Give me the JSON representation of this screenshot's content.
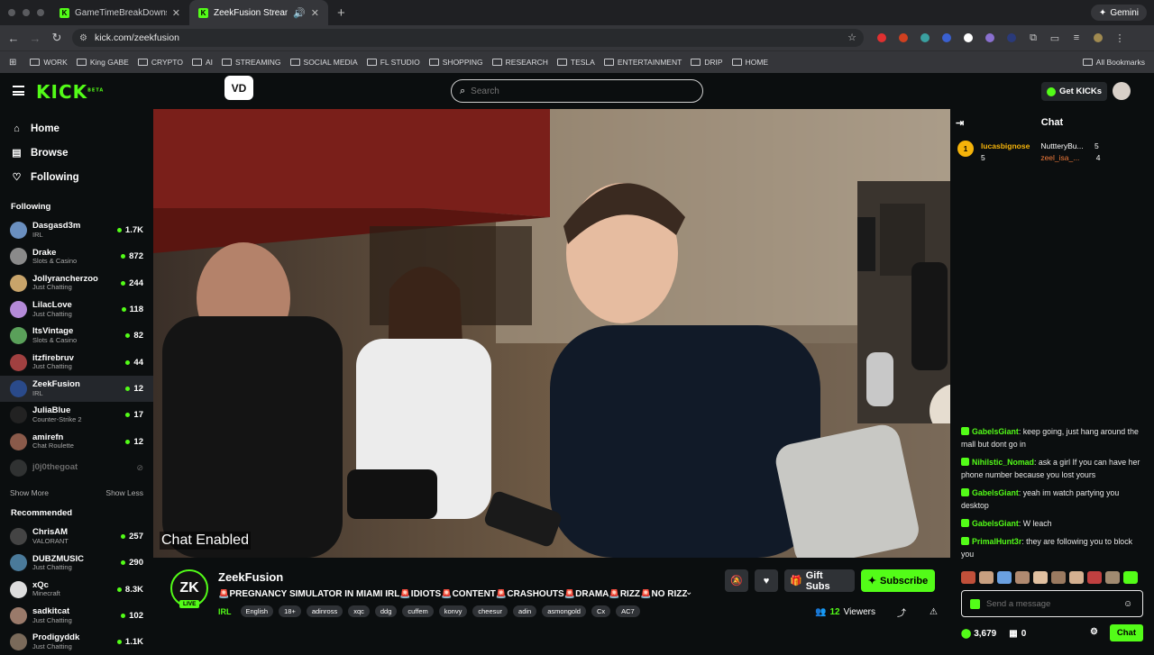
{
  "browser": {
    "tabs": [
      {
        "title": "GameTimeBreakDowns - Wa"
      },
      {
        "title": "ZeekFusion Stream - Wat"
      }
    ],
    "gemini_label": "Gemini",
    "url": "kick.com/zeekfusion",
    "bookmarks": [
      "WORK",
      "King GABE",
      "CRYPTO",
      "AI",
      "STREAMING",
      "SOCIAL MEDIA",
      "FL STUDIO",
      "SHOPPING",
      "RESEARCH",
      "TESLA",
      "ENTERTAINMENT",
      "DRIP",
      "HOME"
    ],
    "all_bookmarks": "All Bookmarks"
  },
  "header": {
    "logo": "KICK",
    "logo_badge": "BETA",
    "vd_label": "VD",
    "search_placeholder": "Search",
    "get_kicks": "Get KICKs"
  },
  "sidebar": {
    "nav": [
      {
        "label": "Home",
        "icon": "home-icon"
      },
      {
        "label": "Browse",
        "icon": "browse-icon"
      },
      {
        "label": "Following",
        "icon": "heart-icon"
      }
    ],
    "following_title": "Following",
    "following": [
      {
        "name": "Dasgasd3m",
        "game": "IRL",
        "viewers": "1.7K",
        "color": "#6a8fbf"
      },
      {
        "name": "Drake",
        "game": "Slots & Casino",
        "viewers": "872",
        "color": "#8a8a8a"
      },
      {
        "name": "Jollyrancherzoo",
        "game": "Just Chatting",
        "viewers": "244",
        "color": "#c8a46a"
      },
      {
        "name": "LilacLove",
        "game": "Just Chatting",
        "viewers": "118",
        "color": "#b48ad8"
      },
      {
        "name": "ItsVintage",
        "game": "Slots & Casino",
        "viewers": "82",
        "color": "#5aa05a"
      },
      {
        "name": "itzfirebruv",
        "game": "Just Chatting",
        "viewers": "44",
        "color": "#a04040"
      },
      {
        "name": "ZeekFusion",
        "game": "IRL",
        "viewers": "12",
        "color": "#2a4a8a"
      },
      {
        "name": "JuliaBlue",
        "game": "Counter-Strike 2",
        "viewers": "17",
        "color": "#222"
      },
      {
        "name": "amirefn",
        "game": "Chat Roulette",
        "viewers": "12",
        "color": "#8a5a4a"
      }
    ],
    "offline_channel": "j0j0thegoat",
    "show_more": "Show More",
    "show_less": "Show Less",
    "recommended_title": "Recommended",
    "recommended": [
      {
        "name": "ChrisAM",
        "game": "VALORANT",
        "viewers": "257",
        "color": "#444"
      },
      {
        "name": "DUBZMUSIC",
        "game": "Just Chatting",
        "viewers": "290",
        "color": "#4a7a9a"
      },
      {
        "name": "xQc",
        "game": "Minecraft",
        "viewers": "8.3K",
        "color": "#ddd"
      },
      {
        "name": "sadkitcat",
        "game": "Just Chatting",
        "viewers": "102",
        "color": "#9a7a6a"
      },
      {
        "name": "Prodigyddk",
        "game": "Just Chatting",
        "viewers": "1.1K",
        "color": "#7a6a5a"
      }
    ]
  },
  "player": {
    "caption": "Chat Enabled"
  },
  "channel": {
    "avatar": "ZK",
    "live": "LIVE",
    "name": "ZeekFusion",
    "title": "🚨PREGNANCY SIMULATOR IN MIAMI IRL🚨IDIOTS🚨CONTENT🚨CRASHOUTS🚨DRAMA🚨RIZZ🚨NO RIZZ🚨...",
    "category": "IRL",
    "tags": [
      "English",
      "18+",
      "adinross",
      "xqc",
      "ddg",
      "cuffem",
      "konvy",
      "cheesur",
      "adin",
      "asmongold",
      "Cx",
      "AC7"
    ],
    "gift_subs": "Gift Subs",
    "subscribe": "Subscribe",
    "viewers_count": "12",
    "viewers_label": "Viewers"
  },
  "chat": {
    "title": "Chat",
    "leaderboard": [
      {
        "rank": "1",
        "name": "lucasbignose",
        "count": "5"
      },
      {
        "name": "NuttteryBu...",
        "count": "5"
      },
      {
        "name": "zeel_isa_...",
        "count": "4"
      }
    ],
    "messages": [
      {
        "user": "GabelsGiant",
        "text": "keep going, just hang around the mall but dont go in",
        "color": "#53fc18"
      },
      {
        "user": "Nihilstic_Nomad",
        "text": "ask a girl If you can have her phone number because you lost yours",
        "color": "#53fc18"
      },
      {
        "user": "GabelsGiant",
        "text": "yeah im watch partying you desktop",
        "color": "#53fc18"
      },
      {
        "user": "GabelsGiant",
        "text": "W leach",
        "color": "#53fc18"
      },
      {
        "user": "PrimalHunt3r",
        "text": "they are following you to block you",
        "color": "#53fc18"
      }
    ],
    "input_placeholder": "Send a message",
    "kicks_balance": "3,679",
    "points": "0",
    "send_label": "Chat"
  },
  "colors": {
    "brand": "#53fc18",
    "background": "#0b0e0f"
  }
}
